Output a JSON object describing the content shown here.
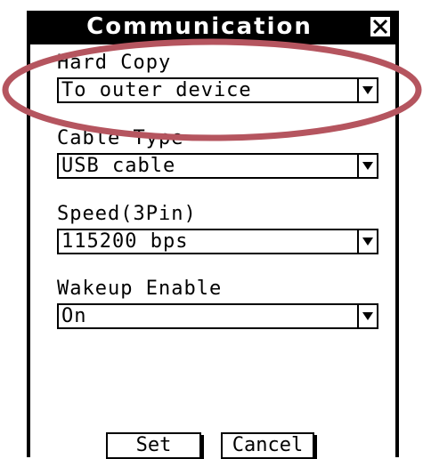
{
  "dialog": {
    "title": "Communication",
    "close_glyph": "X"
  },
  "fields": [
    {
      "label": "Hard Copy",
      "value": "To outer device"
    },
    {
      "label": "Cable Type",
      "value": "USB cable"
    },
    {
      "label": "Speed(3Pin)",
      "value": "115200 bps"
    },
    {
      "label": "Wakeup Enable",
      "value": "On"
    }
  ],
  "buttons": {
    "set": "Set",
    "cancel": "Cancel"
  },
  "annotation": {
    "color": "#b5555f",
    "shape": "ellipse"
  },
  "icons": {
    "close": "close-icon",
    "dropdown": "chevron-down-icon"
  }
}
